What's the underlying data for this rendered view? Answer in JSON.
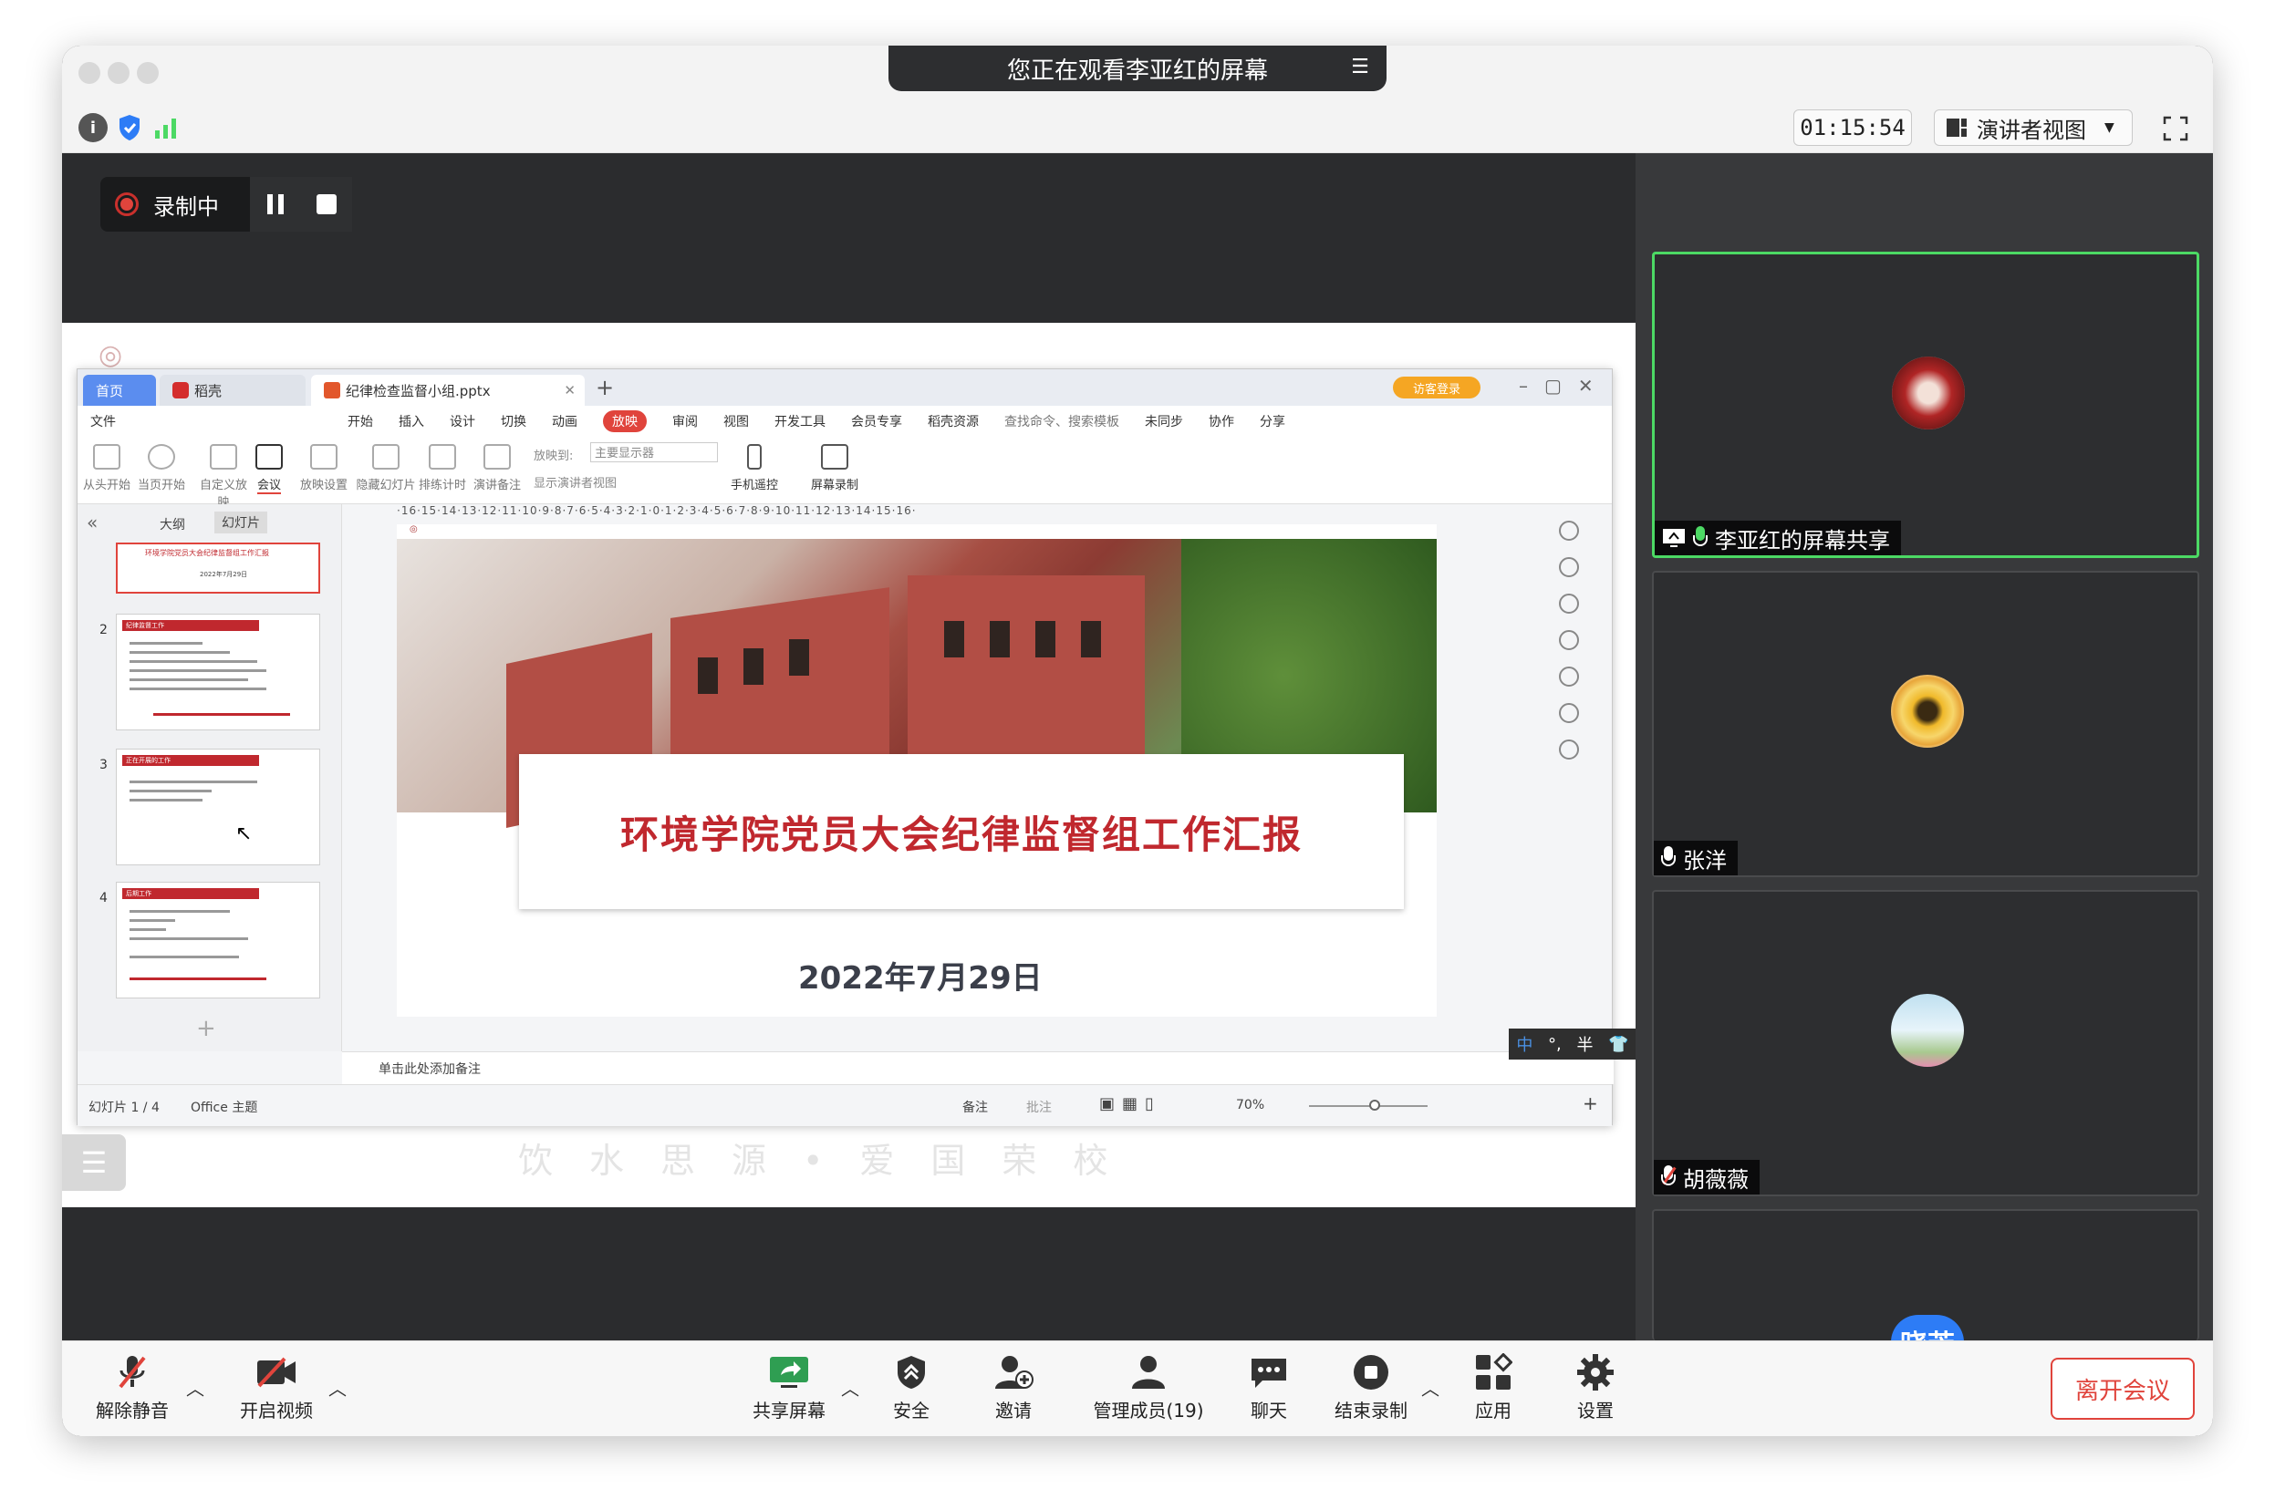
{
  "window": {
    "title": "您正在观看李亚红的屏幕"
  },
  "toolbar": {
    "timer": "01:15:54",
    "view_mode": "演讲者视图"
  },
  "recording": {
    "label": "录制中"
  },
  "wps": {
    "tabs": [
      "首页",
      "稻壳",
      "纪律检查监督小组.pptx"
    ],
    "guest_login": "访客登录",
    "menu": [
      "文件",
      "开始",
      "插入",
      "设计",
      "切换",
      "动画",
      "放映",
      "审阅",
      "视图",
      "开发工具",
      "会员专享",
      "稻壳资源",
      "查找命令、搜索模板",
      "未同步",
      "协作",
      "分享"
    ],
    "ribbon": [
      "从头开始",
      "当页开始",
      "自定义放映",
      "会议",
      "放映设置",
      "隐藏幻灯片",
      "排练计时",
      "演讲备注",
      "放映到:",
      "主要显示器",
      "显示演讲者视图",
      "手机遥控",
      "屏幕录制"
    ],
    "panel_tabs": [
      "大纲",
      "幻灯片"
    ],
    "thumbs": [
      {
        "num": "2",
        "header": "纪律监督工作"
      },
      {
        "num": "3",
        "header": "正在开展的工作"
      },
      {
        "num": "4",
        "header": "后期工作"
      }
    ],
    "thumb1_title": "环境学院党员大会纪律监督组工作汇报",
    "thumb1_date": "2022年7月29日",
    "ruler": "·16·15·14·13·12·11·10·9·8·7·6·5·4·3·2·1·0·1·2·3·4·5·6·7·8·9·10·11·12·13·14·15·16·",
    "slide_title": "环境学院党员大会纪律监督组工作汇报",
    "slide_date": "2022年7月29日",
    "notes_placeholder": "单击此处添加备注",
    "status_slide": "幻灯片 1 / 4",
    "status_theme": "Office 主题",
    "status_notes": "备注",
    "status_comments": "批注",
    "zoom": "70%",
    "ime": [
      "中",
      "°,",
      "半"
    ]
  },
  "share_bg": {
    "motto": "饮水思源•爱国荣校"
  },
  "participants": [
    {
      "name": "李亚红的屏幕共享",
      "active": true
    },
    {
      "name": "张洋"
    },
    {
      "name": "胡薇薇"
    },
    {
      "name": "晓芳",
      "avatar_text": "晓芳"
    }
  ],
  "bottombar": {
    "unmute": "解除静音",
    "start_video": "开启视频",
    "share_screen": "共享屏幕",
    "security": "安全",
    "invite": "邀请",
    "members": "管理成员(19)",
    "chat": "聊天",
    "end_recording": "结束录制",
    "apps": "应用",
    "settings": "设置",
    "leave": "离开会议"
  },
  "colors": {
    "accent_green": "#4cd964",
    "danger_red": "#e0443c",
    "slide_red": "#c0282e",
    "wps_orange": "#f5a623",
    "avatar_blue": "#2d7cf6"
  }
}
